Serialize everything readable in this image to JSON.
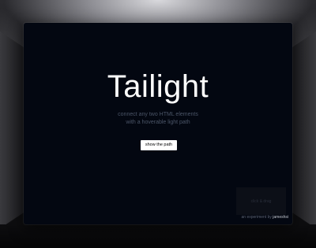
{
  "hero": {
    "title": "Tailight",
    "subtitle_line1": "connect any two HTML elements",
    "subtitle_line2": "with a hoverable light path",
    "cta_label": "show the path"
  },
  "drag_box": {
    "label": "click & drag"
  },
  "credit": {
    "prefix": "an experiment by",
    "author": "jameshsi"
  },
  "colors": {
    "panel_background": "#030711",
    "title": "#ffffff",
    "subtitle": "#4b5568",
    "button_background": "#ffffff",
    "button_text": "#000000"
  }
}
